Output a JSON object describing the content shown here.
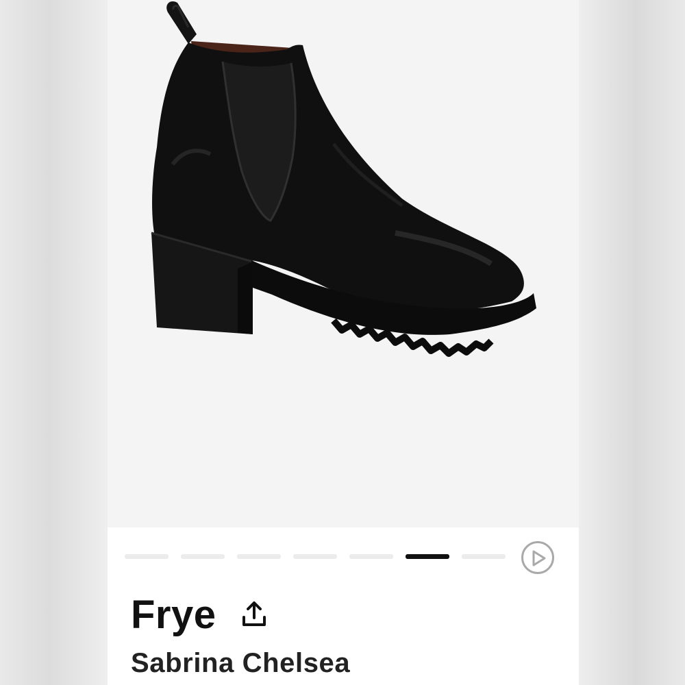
{
  "product": {
    "brand": "Frye",
    "name": "Sabrina Chelsea",
    "image_icon": "ankle-boot-image"
  },
  "gallery": {
    "slide_count": 7,
    "active_index": 5,
    "play_icon": "play-icon"
  },
  "actions": {
    "share_icon": "share-icon"
  },
  "colors": {
    "active_indicator": "#111111",
    "inactive_indicator": "#ececec",
    "image_background": "#f4f4f4",
    "play_ring": "#a9a9a9"
  }
}
